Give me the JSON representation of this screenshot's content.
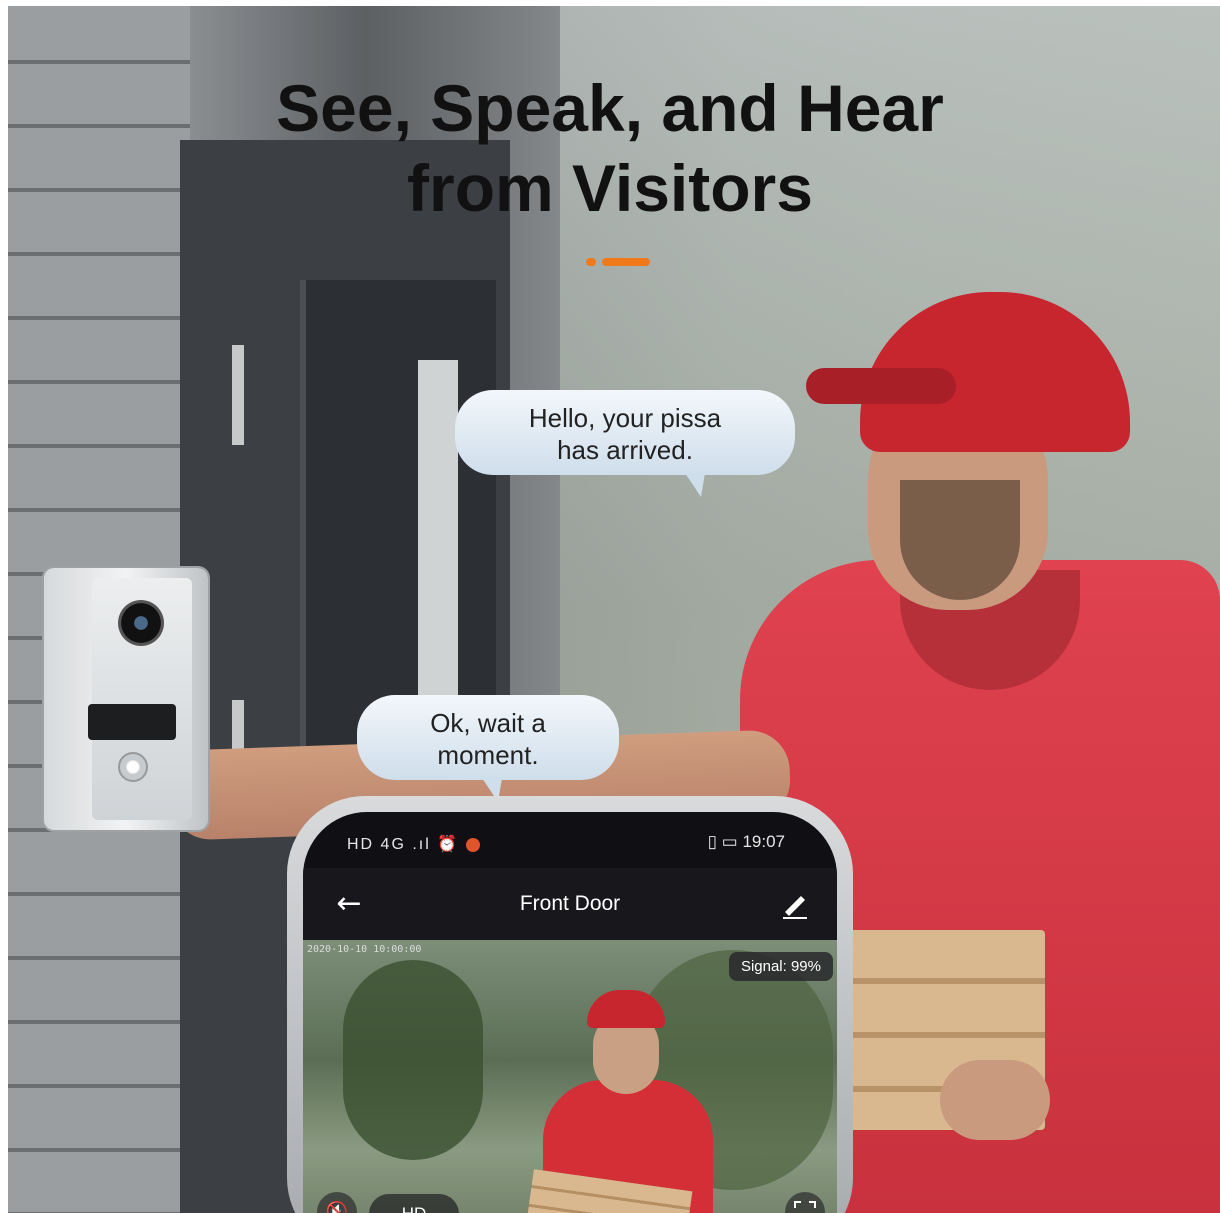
{
  "headline": {
    "line1": "See, Speak, and Hear",
    "line2": "from Visitors"
  },
  "accent_color": "#f07a1a",
  "bubbles": {
    "visitor": {
      "line1": "Hello, your pissa",
      "line2": "has arrived."
    },
    "owner": {
      "line1": "Ok, wait a",
      "line2": "moment."
    }
  },
  "phone": {
    "status": {
      "left_icons": "HD 4G .ıl ⏰",
      "time": "19:07",
      "right_icons": "▯ ▭"
    },
    "app_bar": {
      "back_icon": "arrow-left",
      "title": "Front Door",
      "edit_icon": "pencil"
    },
    "feed": {
      "timestamp": "2020-10-10 10:00:00",
      "signal": "Signal: 99%"
    },
    "controls": {
      "mute_icon": "speaker-muted",
      "quality": "HD",
      "fullscreen_icon": "fullscreen"
    }
  }
}
